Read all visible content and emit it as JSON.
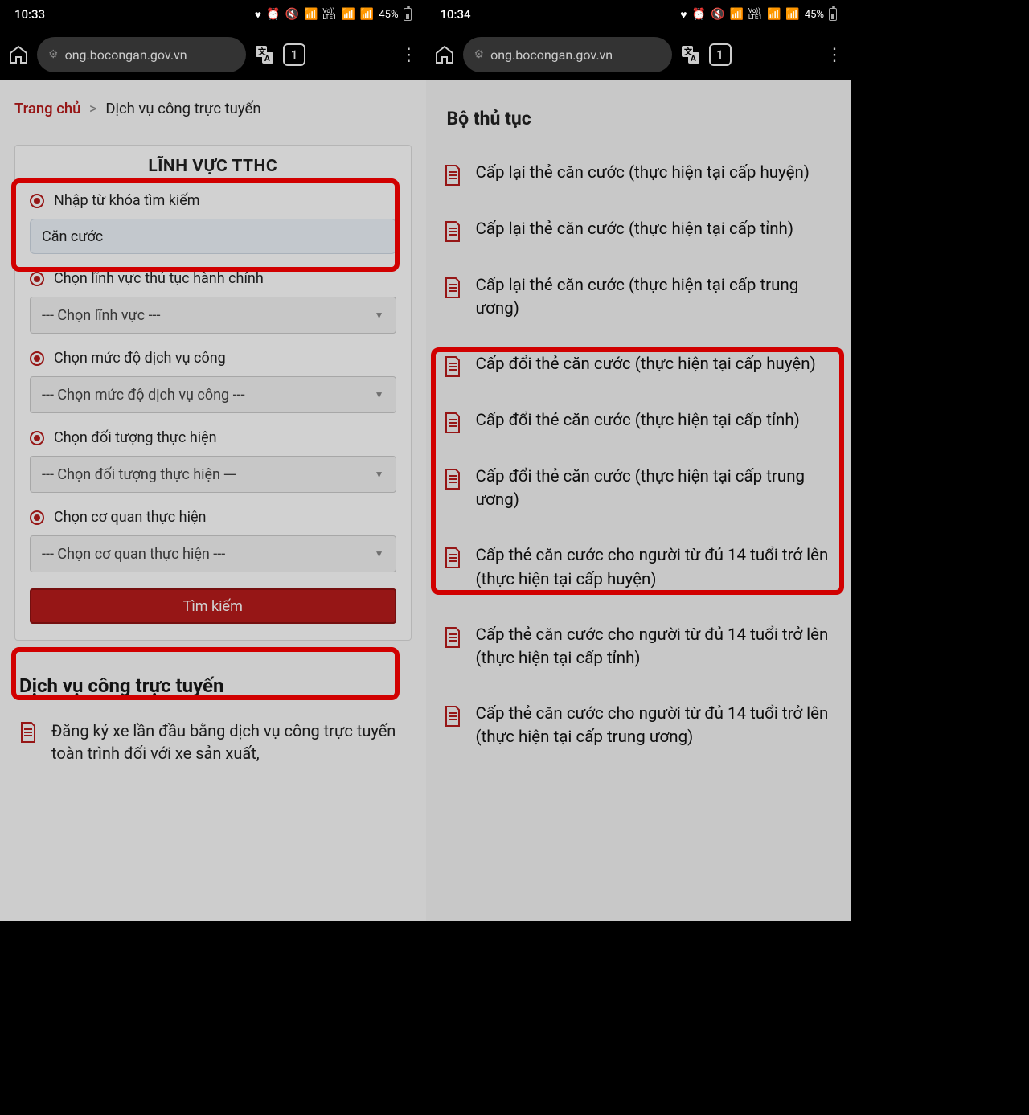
{
  "left": {
    "status": {
      "time": "10:33",
      "battery": "45%",
      "lte": "Vo))\nLTE1"
    },
    "browser": {
      "url": "ong.bocongan.gov.vn",
      "tabs": "1"
    },
    "breadcrumb": {
      "home": "Trang chủ",
      "sep": ">",
      "current": "Dịch vụ công trực tuyến"
    },
    "card": {
      "title": "LĨNH VỰC TTHC",
      "search_label": "Nhập từ khóa tìm kiếm",
      "search_value": "Căn cước",
      "field_linhvuc_label": "Chọn lĩnh vực thủ tục hành chính",
      "field_linhvuc_placeholder": "--- Chọn lĩnh vực ---",
      "field_mucdo_label": "Chọn mức độ dịch vụ công",
      "field_mucdo_placeholder": "--- Chọn mức độ dịch vụ công ---",
      "field_doituong_label": "Chọn đối tượng thực hiện",
      "field_doituong_placeholder": "--- Chọn đối tượng thực hiện ---",
      "field_coquan_label": "Chọn cơ quan thực hiện",
      "field_coquan_placeholder": "--- Chọn cơ quan thực hiện ---",
      "search_btn": "Tìm kiếm"
    },
    "section_heading": "Dịch vụ công trực tuyến",
    "doc_item": "Đăng ký xe lần đầu bằng dịch vụ công trực tuyến toàn trình đối với xe sản xuất,"
  },
  "right": {
    "status": {
      "time": "10:34",
      "battery": "45%"
    },
    "browser": {
      "url": "ong.bocongan.gov.vn",
      "tabs": "1"
    },
    "title": "Bộ thủ tục",
    "items": [
      "Cấp lại thẻ căn cước (thực hiện tại cấp huyện)",
      "Cấp lại thẻ căn cước (thực hiện tại cấp tỉnh)",
      "Cấp lại thẻ căn cước (thực hiện tại cấp trung ương)",
      "Cấp đổi thẻ căn cước (thực hiện tại cấp huyện)",
      "Cấp đổi thẻ căn cước (thực hiện tại cấp tỉnh)",
      "Cấp đổi thẻ căn cước (thực hiện tại cấp trung ương)",
      "Cấp thẻ căn cước cho người từ đủ 14 tuổi trở lên (thực hiện tại cấp huyện)",
      "Cấp thẻ căn cước cho người từ đủ 14 tuổi trở lên (thực hiện tại cấp tỉnh)",
      "Cấp thẻ căn cước cho người từ đủ 14 tuổi trở lên (thực hiện tại cấp trung ương)"
    ]
  }
}
